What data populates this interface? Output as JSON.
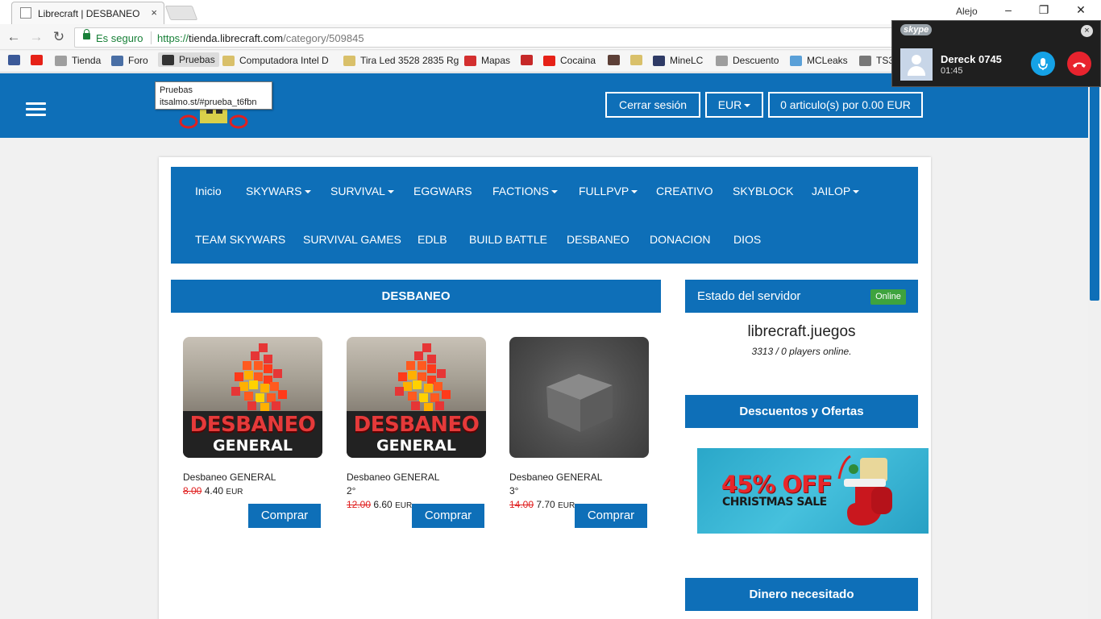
{
  "browser": {
    "tab_title": "Librecraft | DESBANEO",
    "tab_close": "×",
    "window_user": "Alejo",
    "secure_label": "Es seguro",
    "url_proto": "https://",
    "url_host": "tienda.librecraft.com",
    "url_path": "/category/509845",
    "win_min": "–",
    "win_max": "❐",
    "win_close": "✕",
    "back": "←",
    "forward": "→",
    "reload": "↻"
  },
  "bookmarks": [
    {
      "label": "",
      "color": "#3b5998"
    },
    {
      "label": "",
      "color": "#e62117"
    },
    {
      "label": "Tienda",
      "color": "#9e9e9e"
    },
    {
      "label": "Foro",
      "color": "#4a6fa5"
    },
    {
      "label": "Pruebas",
      "color": "#333333"
    },
    {
      "label": "Computadora Intel D",
      "color": "#d9c06a"
    },
    {
      "label": "Tira Led 3528 2835 Rg",
      "color": "#d9c06a"
    },
    {
      "label": "Mapas",
      "color": "#d32f2f"
    },
    {
      "label": "",
      "color": "#c62828"
    },
    {
      "label": "Cocaina",
      "color": "#e62117"
    },
    {
      "label": "",
      "color": "#5d4037"
    },
    {
      "label": "",
      "color": "#d9c06a"
    },
    {
      "label": "MineLC",
      "color": "#2f3b66"
    },
    {
      "label": "Descuento",
      "color": "#9e9e9e"
    },
    {
      "label": "MCLeaks",
      "color": "#5aa0d8"
    },
    {
      "label": "TS3",
      "color": "#777777"
    }
  ],
  "tooltip": {
    "title": "Pruebas",
    "url": "itsalmo.st/#prueba_t6fbn"
  },
  "header": {
    "logout": "Cerrar sesión",
    "currency": "EUR",
    "cart": "0 articulo(s) por 0.00 EUR"
  },
  "categories_row1": [
    {
      "label": "Inicio",
      "dropdown": false
    },
    {
      "label": "SKYWARS",
      "dropdown": true
    },
    {
      "label": "SURVIVAL",
      "dropdown": true
    },
    {
      "label": "EGGWARS",
      "dropdown": false
    },
    {
      "label": "FACTIONS",
      "dropdown": true
    },
    {
      "label": "FULLPVP",
      "dropdown": true
    },
    {
      "label": "CREATIVO",
      "dropdown": false
    },
    {
      "label": "SKYBLOCK",
      "dropdown": false
    },
    {
      "label": "JAILOP",
      "dropdown": true
    }
  ],
  "categories_row2": [
    {
      "label": "TEAM SKYWARS"
    },
    {
      "label": "SURVIVAL GAMES"
    },
    {
      "label": "EDLB"
    },
    {
      "label": "BUILD BATTLE"
    },
    {
      "label": "DESBANEO"
    },
    {
      "label": "DONACION"
    },
    {
      "label": "DIOS"
    }
  ],
  "main_panel": {
    "title": "DESBANEO",
    "products": [
      {
        "name": "Desbaneo GENERAL",
        "rank": "",
        "old_price": "8.00",
        "price": "4.40",
        "currency": "EUR",
        "button": "Comprar",
        "image": "fire-banner",
        "banner_l1": "DESBANEO",
        "banner_l2": "GENERAL"
      },
      {
        "name": "Desbaneo GENERAL",
        "rank": "2°",
        "old_price": "12.00",
        "price": "6.60",
        "currency": "EUR",
        "button": "Comprar",
        "image": "fire-banner",
        "banner_l1": "DESBANEO",
        "banner_l2": "GENERAL"
      },
      {
        "name": "Desbaneo GENERAL",
        "rank": "3°",
        "old_price": "14.00",
        "price": "7.70",
        "currency": "EUR",
        "button": "Comprar",
        "image": "box",
        "banner_l1": "",
        "banner_l2": ""
      }
    ]
  },
  "server_status": {
    "title": "Estado del servidor",
    "badge": "Online",
    "server": "librecraft.juegos",
    "players": "3313 / 0 players online."
  },
  "offers": {
    "title": "Descuentos y Ofertas",
    "promo_l1": "45% OFF",
    "promo_l2": "CHRISTMAS SALE"
  },
  "money": {
    "title": "Dinero necesitado"
  },
  "skype": {
    "brand": "skype",
    "caller": "Dereck 0745",
    "duration": "01:45",
    "close": "×"
  },
  "colors": {
    "brand_blue": "#0e6fb8",
    "online_green": "#3ea33e",
    "old_price_red": "#e02020",
    "skype_call_blue": "#15a2e6",
    "skype_hangup_red": "#e8232e"
  }
}
